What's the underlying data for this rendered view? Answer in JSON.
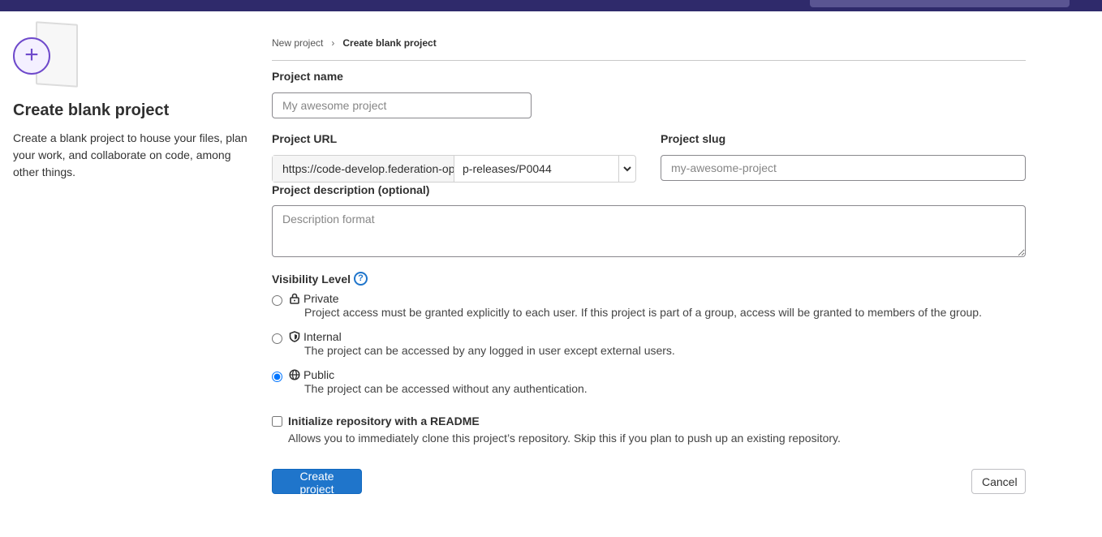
{
  "page": {
    "title": "Create blank project",
    "description": "Create a blank project to house your files, plan your work, and collaborate on code, among other things."
  },
  "breadcrumb": {
    "parent": "New project",
    "separator": "›",
    "current": "Create blank project"
  },
  "form": {
    "project_name": {
      "label": "Project name",
      "placeholder": "My awesome project",
      "value": ""
    },
    "project_url": {
      "label": "Project URL",
      "prefix": "https://code-develop.federation-op",
      "namespace": "p-releases/P0044"
    },
    "project_slug": {
      "label": "Project slug",
      "placeholder": "my-awesome-project",
      "value": ""
    },
    "project_description": {
      "label": "Project description (optional)",
      "placeholder": "Description format"
    },
    "visibility": {
      "label": "Visibility Level",
      "selected": "public",
      "options": [
        {
          "id": "private",
          "icon": "lock-icon",
          "title": "Private",
          "description": "Project access must be granted explicitly to each user. If this project is part of a group, access will be granted to members of the group."
        },
        {
          "id": "internal",
          "icon": "shield-icon",
          "title": "Internal",
          "description": "The project can be accessed by any logged in user except external users."
        },
        {
          "id": "public",
          "icon": "globe-icon",
          "title": "Public",
          "description": "The project can be accessed without any authentication."
        }
      ]
    },
    "readme": {
      "label": "Initialize repository with a README",
      "description": "Allows you to immediately clone this project’s repository. Skip this if you plan to push up an existing repository.",
      "checked": false
    }
  },
  "actions": {
    "create_label": "Create project",
    "cancel_label": "Cancel"
  },
  "colors": {
    "topbar": "#2f2a6b",
    "primary": "#1f75cb",
    "illustration_accent": "#6e49cb"
  }
}
